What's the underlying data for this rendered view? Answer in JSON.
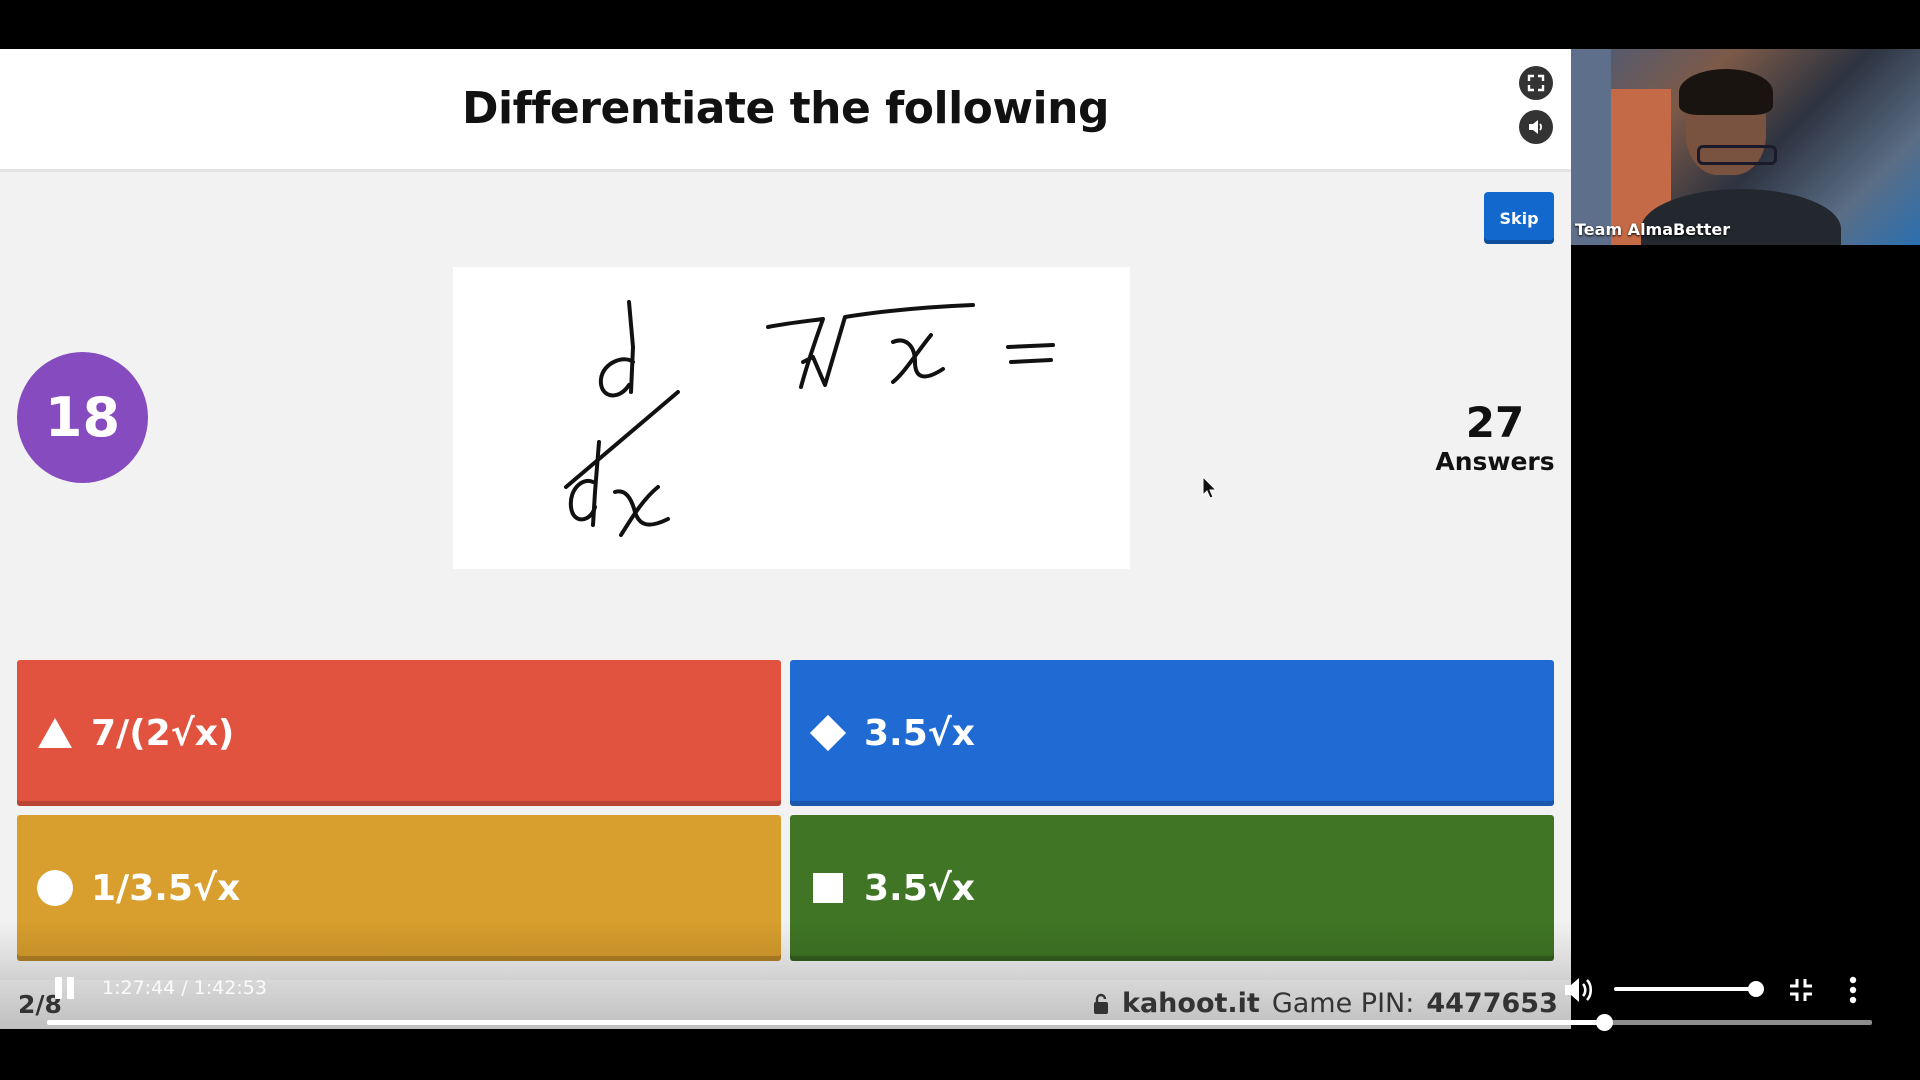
{
  "kahoot": {
    "question_title": "Differentiate the following",
    "skip_label": "Skip",
    "timer_value": "18",
    "answers_count": "27",
    "answers_label": "Answers",
    "question_image_icon": "handwritten-derivative-d-dx-7-sqrt-x",
    "answers": [
      {
        "label": "7/(2√x)",
        "shape": "triangle-icon",
        "color": "#e2533f"
      },
      {
        "label": "3.5√x",
        "shape": "diamond-icon",
        "color": "#1f6bd3"
      },
      {
        "label": "1/3.5√x",
        "shape": "circle-icon",
        "color": "#d89e2e"
      },
      {
        "label": "3.5√x",
        "shape": "square-icon",
        "color": "#3f7525"
      }
    ],
    "question_progress": "2/8",
    "site": "kahoot.it",
    "game_pin_label": "Game PIN:",
    "game_pin": "4477653"
  },
  "video_tile": {
    "name": "Team AlmaBetter"
  },
  "player": {
    "time_display": "1:27:44 / 1:42:53",
    "current_time": "1:27:44",
    "duration": "1:42:53",
    "progress_fraction": 0.853,
    "volume_fraction": 1.0
  }
}
